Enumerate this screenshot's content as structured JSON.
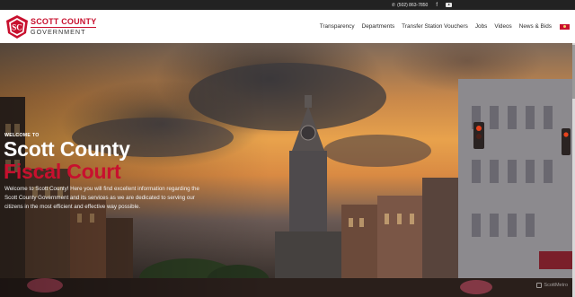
{
  "topbar": {
    "phone": "(502) 863-7850",
    "phone_icon": "phone-icon",
    "facebook_icon": "facebook-icon",
    "youtube_icon": "youtube-icon"
  },
  "header": {
    "logo_line1": "SCOTT COUNTY",
    "logo_line2": "GOVERNMENT",
    "logo_monogram": "SC",
    "nav": [
      "Transparency",
      "Departments",
      "Transfer Station Vouchers",
      "Jobs",
      "Videos",
      "News & Bids"
    ],
    "language_icon": "flag-icon"
  },
  "hero": {
    "welcome": "WELCOME TO",
    "title_line1": "Scott County",
    "title_line2": "Fiscal Court",
    "intro": "Welcome to Scott County! Here you will find excellent information regarding the Scott County Government and its services as we are dedicated to serving our citizens in the most efficient and effective way possible.",
    "watermark": "ScottMetro"
  },
  "colors": {
    "brand_red": "#c8102e",
    "topbar_bg": "#222222",
    "header_bg": "#ffffff"
  }
}
